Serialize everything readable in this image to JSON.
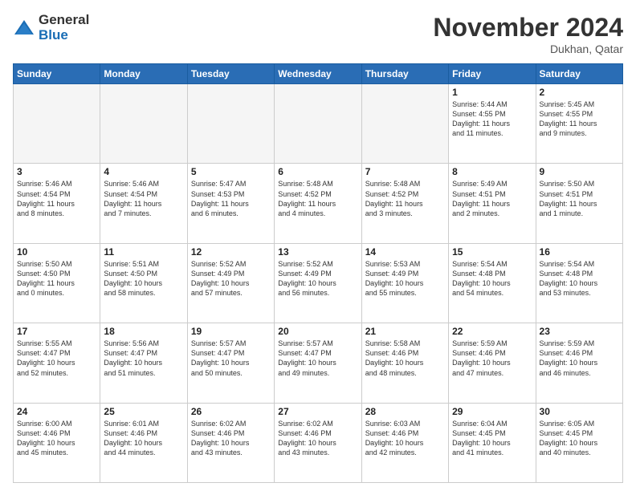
{
  "header": {
    "logo_general": "General",
    "logo_blue": "Blue",
    "month_title": "November 2024",
    "location": "Dukhan, Qatar"
  },
  "weekdays": [
    "Sunday",
    "Monday",
    "Tuesday",
    "Wednesday",
    "Thursday",
    "Friday",
    "Saturday"
  ],
  "weeks": [
    [
      {
        "day": "",
        "info": ""
      },
      {
        "day": "",
        "info": ""
      },
      {
        "day": "",
        "info": ""
      },
      {
        "day": "",
        "info": ""
      },
      {
        "day": "",
        "info": ""
      },
      {
        "day": "1",
        "info": "Sunrise: 5:44 AM\nSunset: 4:55 PM\nDaylight: 11 hours\nand 11 minutes."
      },
      {
        "day": "2",
        "info": "Sunrise: 5:45 AM\nSunset: 4:55 PM\nDaylight: 11 hours\nand 9 minutes."
      }
    ],
    [
      {
        "day": "3",
        "info": "Sunrise: 5:46 AM\nSunset: 4:54 PM\nDaylight: 11 hours\nand 8 minutes."
      },
      {
        "day": "4",
        "info": "Sunrise: 5:46 AM\nSunset: 4:54 PM\nDaylight: 11 hours\nand 7 minutes."
      },
      {
        "day": "5",
        "info": "Sunrise: 5:47 AM\nSunset: 4:53 PM\nDaylight: 11 hours\nand 6 minutes."
      },
      {
        "day": "6",
        "info": "Sunrise: 5:48 AM\nSunset: 4:52 PM\nDaylight: 11 hours\nand 4 minutes."
      },
      {
        "day": "7",
        "info": "Sunrise: 5:48 AM\nSunset: 4:52 PM\nDaylight: 11 hours\nand 3 minutes."
      },
      {
        "day": "8",
        "info": "Sunrise: 5:49 AM\nSunset: 4:51 PM\nDaylight: 11 hours\nand 2 minutes."
      },
      {
        "day": "9",
        "info": "Sunrise: 5:50 AM\nSunset: 4:51 PM\nDaylight: 11 hours\nand 1 minute."
      }
    ],
    [
      {
        "day": "10",
        "info": "Sunrise: 5:50 AM\nSunset: 4:50 PM\nDaylight: 11 hours\nand 0 minutes."
      },
      {
        "day": "11",
        "info": "Sunrise: 5:51 AM\nSunset: 4:50 PM\nDaylight: 10 hours\nand 58 minutes."
      },
      {
        "day": "12",
        "info": "Sunrise: 5:52 AM\nSunset: 4:49 PM\nDaylight: 10 hours\nand 57 minutes."
      },
      {
        "day": "13",
        "info": "Sunrise: 5:52 AM\nSunset: 4:49 PM\nDaylight: 10 hours\nand 56 minutes."
      },
      {
        "day": "14",
        "info": "Sunrise: 5:53 AM\nSunset: 4:49 PM\nDaylight: 10 hours\nand 55 minutes."
      },
      {
        "day": "15",
        "info": "Sunrise: 5:54 AM\nSunset: 4:48 PM\nDaylight: 10 hours\nand 54 minutes."
      },
      {
        "day": "16",
        "info": "Sunrise: 5:54 AM\nSunset: 4:48 PM\nDaylight: 10 hours\nand 53 minutes."
      }
    ],
    [
      {
        "day": "17",
        "info": "Sunrise: 5:55 AM\nSunset: 4:47 PM\nDaylight: 10 hours\nand 52 minutes."
      },
      {
        "day": "18",
        "info": "Sunrise: 5:56 AM\nSunset: 4:47 PM\nDaylight: 10 hours\nand 51 minutes."
      },
      {
        "day": "19",
        "info": "Sunrise: 5:57 AM\nSunset: 4:47 PM\nDaylight: 10 hours\nand 50 minutes."
      },
      {
        "day": "20",
        "info": "Sunrise: 5:57 AM\nSunset: 4:47 PM\nDaylight: 10 hours\nand 49 minutes."
      },
      {
        "day": "21",
        "info": "Sunrise: 5:58 AM\nSunset: 4:46 PM\nDaylight: 10 hours\nand 48 minutes."
      },
      {
        "day": "22",
        "info": "Sunrise: 5:59 AM\nSunset: 4:46 PM\nDaylight: 10 hours\nand 47 minutes."
      },
      {
        "day": "23",
        "info": "Sunrise: 5:59 AM\nSunset: 4:46 PM\nDaylight: 10 hours\nand 46 minutes."
      }
    ],
    [
      {
        "day": "24",
        "info": "Sunrise: 6:00 AM\nSunset: 4:46 PM\nDaylight: 10 hours\nand 45 minutes."
      },
      {
        "day": "25",
        "info": "Sunrise: 6:01 AM\nSunset: 4:46 PM\nDaylight: 10 hours\nand 44 minutes."
      },
      {
        "day": "26",
        "info": "Sunrise: 6:02 AM\nSunset: 4:46 PM\nDaylight: 10 hours\nand 43 minutes."
      },
      {
        "day": "27",
        "info": "Sunrise: 6:02 AM\nSunset: 4:46 PM\nDaylight: 10 hours\nand 43 minutes."
      },
      {
        "day": "28",
        "info": "Sunrise: 6:03 AM\nSunset: 4:46 PM\nDaylight: 10 hours\nand 42 minutes."
      },
      {
        "day": "29",
        "info": "Sunrise: 6:04 AM\nSunset: 4:45 PM\nDaylight: 10 hours\nand 41 minutes."
      },
      {
        "day": "30",
        "info": "Sunrise: 6:05 AM\nSunset: 4:45 PM\nDaylight: 10 hours\nand 40 minutes."
      }
    ]
  ]
}
